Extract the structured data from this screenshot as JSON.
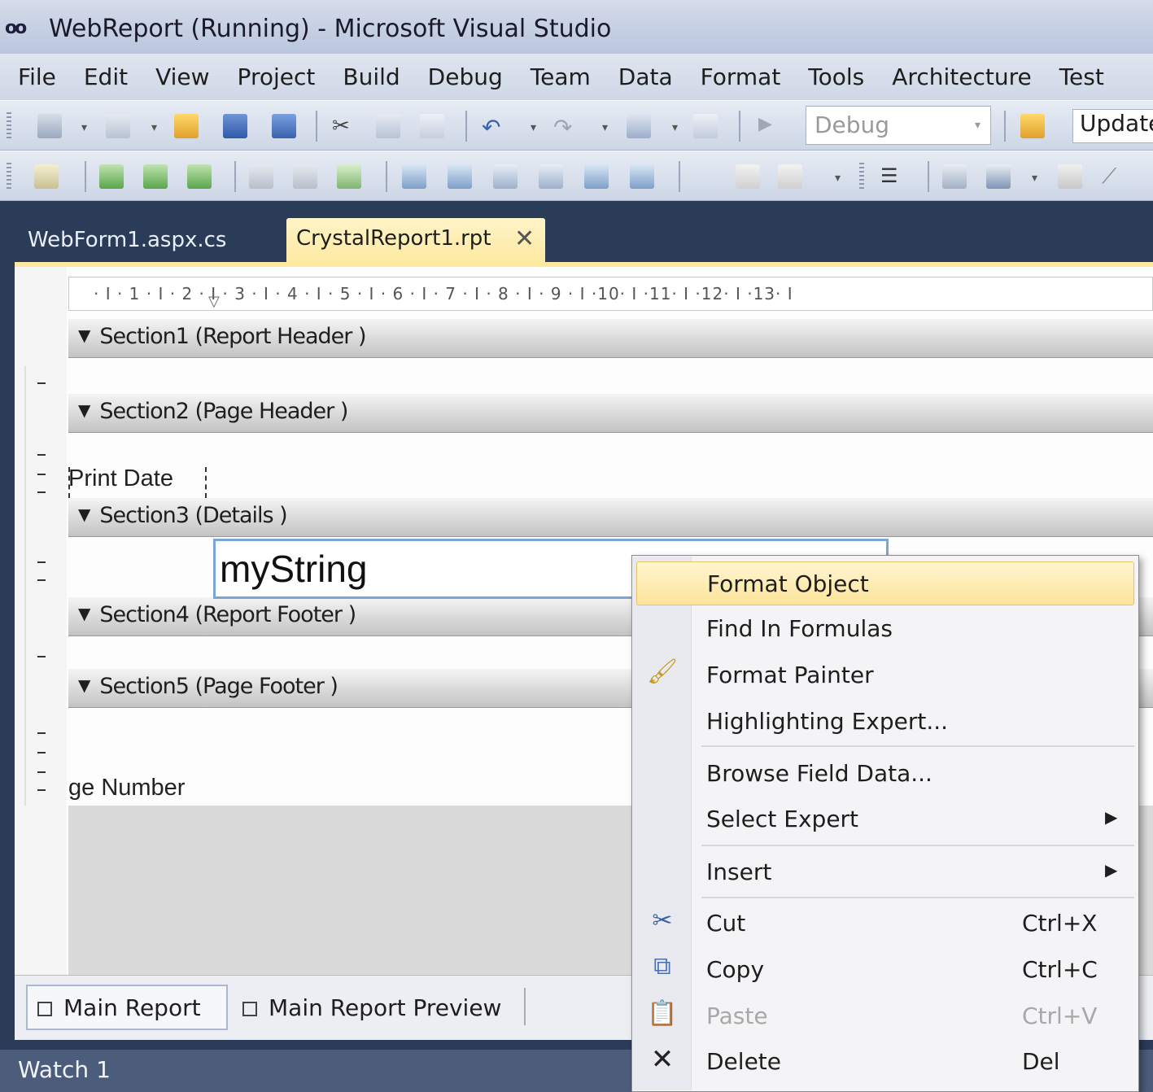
{
  "window": {
    "title": "WebReport (Running) - Microsoft Visual Studio",
    "logo_text": "oo"
  },
  "menu": [
    "File",
    "Edit",
    "View",
    "Project",
    "Build",
    "Debug",
    "Team",
    "Data",
    "Format",
    "Tools",
    "Architecture",
    "Test"
  ],
  "toolbar": {
    "config_combo": "Debug",
    "update_label": "Update"
  },
  "tabs": [
    {
      "label": "WebForm1.aspx.cs"
    },
    {
      "label": "CrystalReport1.rpt",
      "close": "✕"
    }
  ],
  "ruler": {
    "text": "· I · 1 · I · 2 · I · 3 · I · 4 · I · 5 · I · 6 · I · 7 · I · 8 · I · 9 · I ·10· I ·11· I ·12· I ·13· I"
  },
  "sections": [
    "Section1 (Report Header )",
    "Section2 (Page Header )",
    "Section3 (Details )",
    "Section4 (Report Footer )",
    "Section5 (Page Footer )"
  ],
  "fields": {
    "print_date": "Print Date",
    "my_string": "myString",
    "page_number": "ge Number"
  },
  "bottom_tabs": [
    "Main Report",
    "Main Report Preview"
  ],
  "watch": {
    "label": "Watch 1"
  },
  "context_menu": {
    "items": [
      {
        "label": "Format Object",
        "highlight": true
      },
      {
        "label": "Find In Formulas"
      },
      {
        "label": "Format Painter",
        "icon": "brush-icon"
      },
      {
        "label": "Highlighting Expert..."
      },
      {
        "label": "Browse Field Data..."
      },
      {
        "label": "Select Expert",
        "submenu": true
      },
      {
        "label": "Insert",
        "submenu": true
      },
      {
        "label": "Cut",
        "shortcut": "Ctrl+X",
        "icon": "scissors-icon"
      },
      {
        "label": "Copy",
        "shortcut": "Ctrl+C",
        "icon": "copy-icon"
      },
      {
        "label": "Paste",
        "shortcut": "Ctrl+V",
        "icon": "paste-icon",
        "disabled": true
      },
      {
        "label": "Delete",
        "shortcut": "Del",
        "icon": "delete-icon"
      }
    ]
  },
  "colors": {
    "frame": "#2b3c59",
    "active_tab": "#fde9a0",
    "highlight": "#fde49a",
    "selection_border": "#7ba4d7"
  }
}
